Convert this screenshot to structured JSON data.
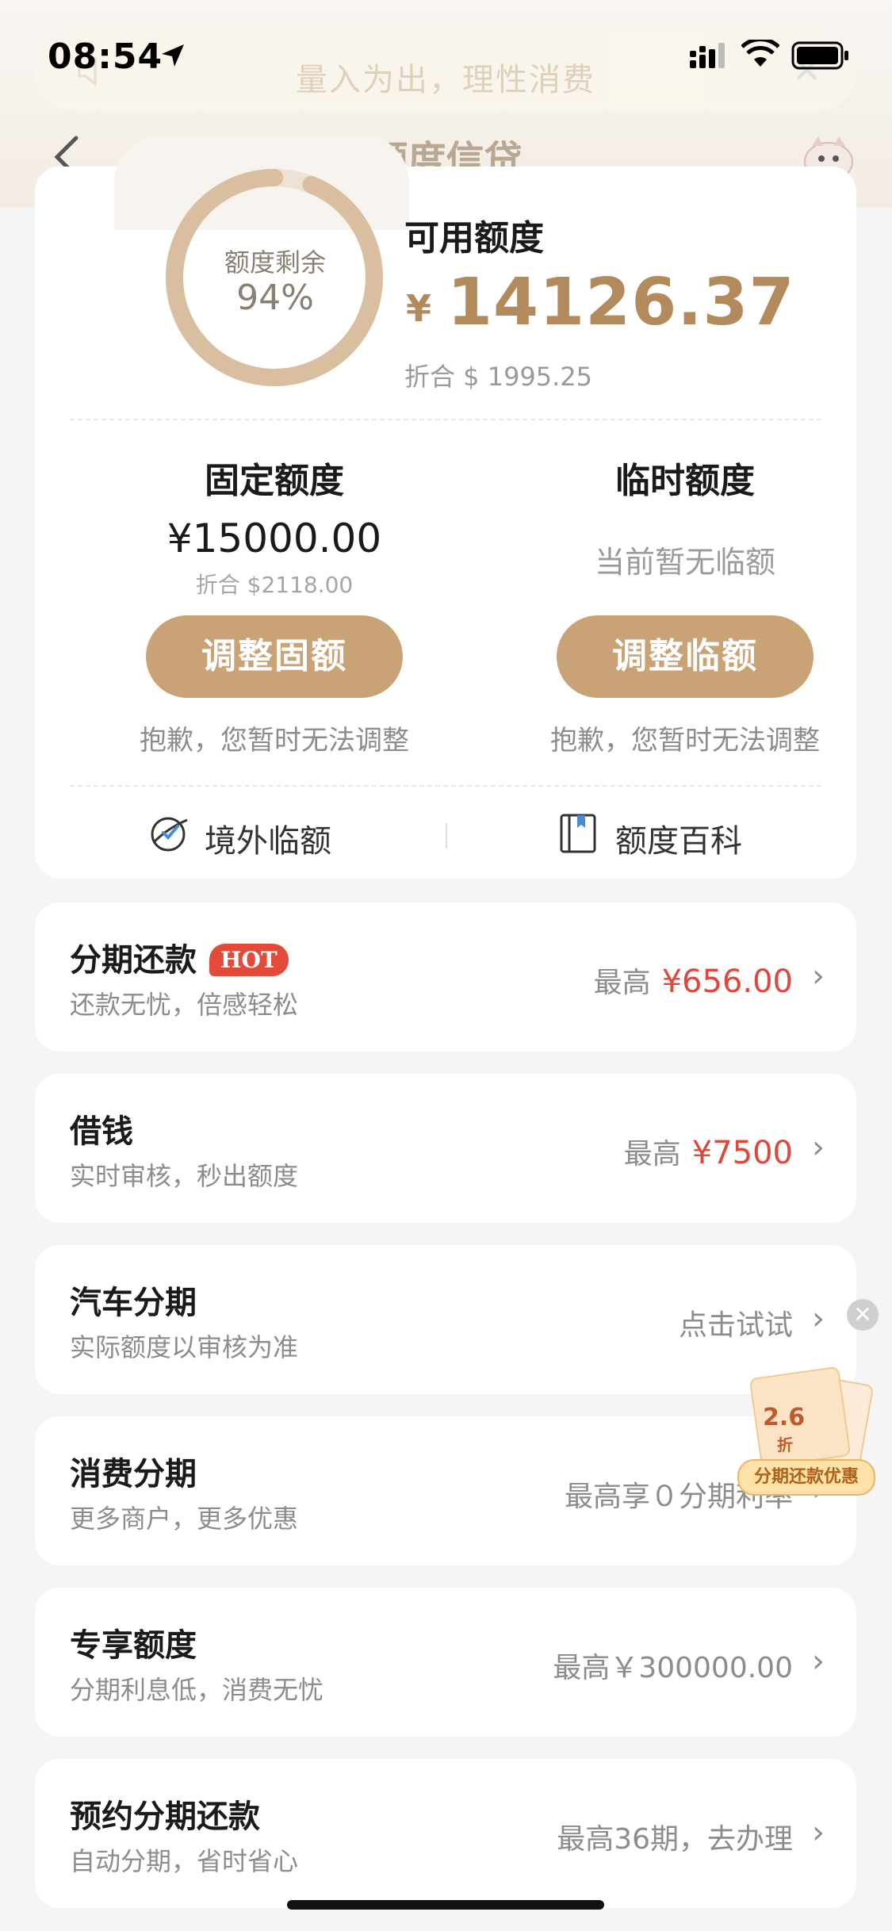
{
  "status_bar": {
    "time": "08:54"
  },
  "notice": {
    "text": "量入为出，理性消费",
    "close": "✕"
  },
  "nav": {
    "title": "额度信贷"
  },
  "summary": {
    "ring_label": "额度剩余",
    "ring_percent_text": "94%",
    "ring_fraction": 0.94,
    "available_title": "可用额度",
    "currency": "¥",
    "available_amount": "14126.37",
    "available_converted": "折合 $ 1995.25"
  },
  "fixed": {
    "title": "固定额度",
    "amount": "¥15000.00",
    "converted": "折合 $2118.00",
    "button": "调整固额",
    "note": "抱歉，您暂时无法调整"
  },
  "temporary": {
    "title": "临时额度",
    "status": "当前暂无临额",
    "button": "调整临额",
    "note": "抱歉，您暂时无法调整"
  },
  "links": {
    "overseas": "境外临额",
    "encyclopedia": "额度百科"
  },
  "rows": [
    {
      "title": "分期还款",
      "badge": "HOT",
      "sub": "还款无忧，倍感轻松",
      "prefix": "最高",
      "value": "¥656.00"
    },
    {
      "title": "借钱",
      "sub": "实时审核，秒出额度",
      "prefix": "最高",
      "value": "¥7500"
    },
    {
      "title": "汽车分期",
      "sub": "实际额度以审核为准",
      "right": "点击试试"
    },
    {
      "title": "消费分期",
      "sub": "更多商户，更多优惠",
      "right": "最高享０分期利率"
    },
    {
      "title": "专享额度",
      "sub": "分期利息低，消费无忧",
      "right": "最高￥300000.00"
    },
    {
      "title": "预约分期还款",
      "sub": "自动分期，省时省心",
      "right": "最高36期，去办理"
    }
  ],
  "promo": {
    "discount": "2.6",
    "unit": "折",
    "label": "分期还款优惠"
  },
  "colors": {
    "gold": "#c9a276",
    "gold_text": "#b28a5c",
    "red": "#e0473b"
  }
}
